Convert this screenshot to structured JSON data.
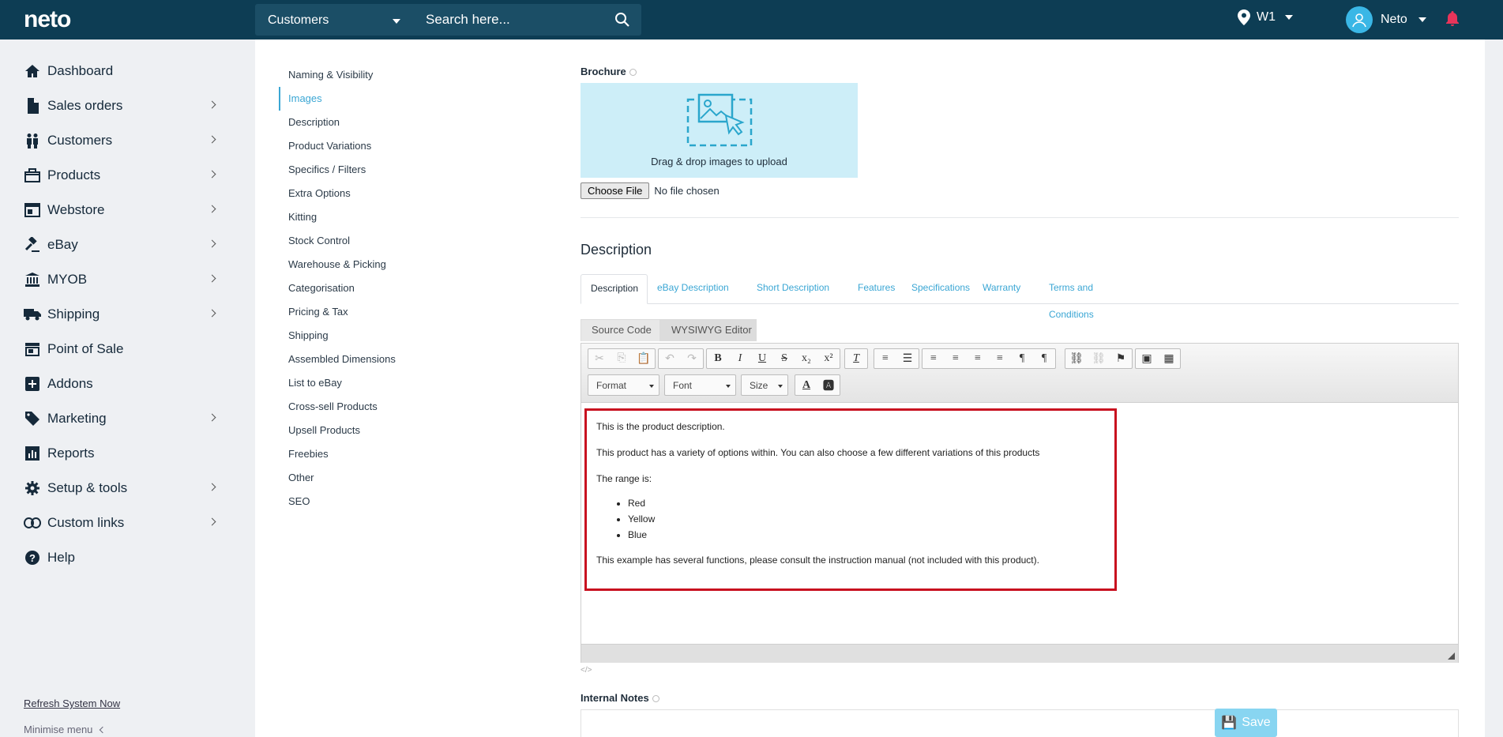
{
  "topbar": {
    "logo": "neto",
    "search_scope": "Customers",
    "search_placeholder": "Search here...",
    "location": "W1",
    "user": "Neto"
  },
  "sidebar": {
    "items": [
      {
        "label": "Dashboard",
        "icon": "home-icon",
        "chevron": false
      },
      {
        "label": "Sales orders",
        "icon": "document-icon",
        "chevron": true
      },
      {
        "label": "Customers",
        "icon": "people-icon",
        "chevron": true
      },
      {
        "label": "Products",
        "icon": "box-icon",
        "chevron": true
      },
      {
        "label": "Webstore",
        "icon": "window-icon",
        "chevron": true
      },
      {
        "label": "eBay",
        "icon": "gavel-icon",
        "chevron": true
      },
      {
        "label": "MYOB",
        "icon": "bank-icon",
        "chevron": true
      },
      {
        "label": "Shipping",
        "icon": "truck-icon",
        "chevron": true
      },
      {
        "label": "Point of Sale",
        "icon": "store-icon",
        "chevron": false
      },
      {
        "label": "Addons",
        "icon": "plus-box-icon",
        "chevron": false
      },
      {
        "label": "Marketing",
        "icon": "tag-icon",
        "chevron": true
      },
      {
        "label": "Reports",
        "icon": "chart-icon",
        "chevron": false
      },
      {
        "label": "Setup & tools",
        "icon": "gear-icon",
        "chevron": true
      },
      {
        "label": "Custom links",
        "icon": "link-icon",
        "chevron": true
      },
      {
        "label": "Help",
        "icon": "help-icon",
        "chevron": false
      }
    ],
    "refresh": "Refresh System Now",
    "minimise": "Minimise menu"
  },
  "section_nav": {
    "items": [
      "Naming & Visibility",
      "Images",
      "Description",
      "Product Variations",
      "Specifics / Filters",
      "Extra Options",
      "Kitting",
      "Stock Control",
      "Warehouse & Picking",
      "Categorisation",
      "Pricing & Tax",
      "Shipping",
      "Assembled Dimensions",
      "List to eBay",
      "Cross-sell Products",
      "Upsell Products",
      "Freebies",
      "Other",
      "SEO"
    ],
    "active": "Images"
  },
  "brochure": {
    "label": "Brochure",
    "dropzone_text": "Drag & drop images to upload",
    "choose_file": "Choose File",
    "no_file": "No file chosen"
  },
  "description": {
    "title": "Description",
    "tabs": [
      "Description",
      "eBay Description",
      "Short Description",
      "Features",
      "Specifications",
      "Warranty",
      "Terms and Conditions"
    ],
    "subtabs": [
      "Source Code",
      "WYSIWYG Editor"
    ],
    "combos": [
      "Format",
      "Font",
      "Size"
    ],
    "content": {
      "p1": "This is the product description.",
      "p2": "This product has a variety of options within. You can also choose a few different variations of this products",
      "p3": "The range is:",
      "list": [
        "Red",
        "Yellow",
        "Blue"
      ],
      "p4": "This example has several functions, please consult the instruction manual (not included with this product)."
    }
  },
  "internal_notes": {
    "label": "Internal Notes"
  },
  "save": {
    "label": "Save"
  },
  "colors": {
    "topbar": "#0d3d54",
    "accent": "#3aa6d4",
    "highlight_border": "#c8101f",
    "dropzone": "#cdeef8",
    "save": "#88d5f1",
    "bell": "#e8345a"
  }
}
